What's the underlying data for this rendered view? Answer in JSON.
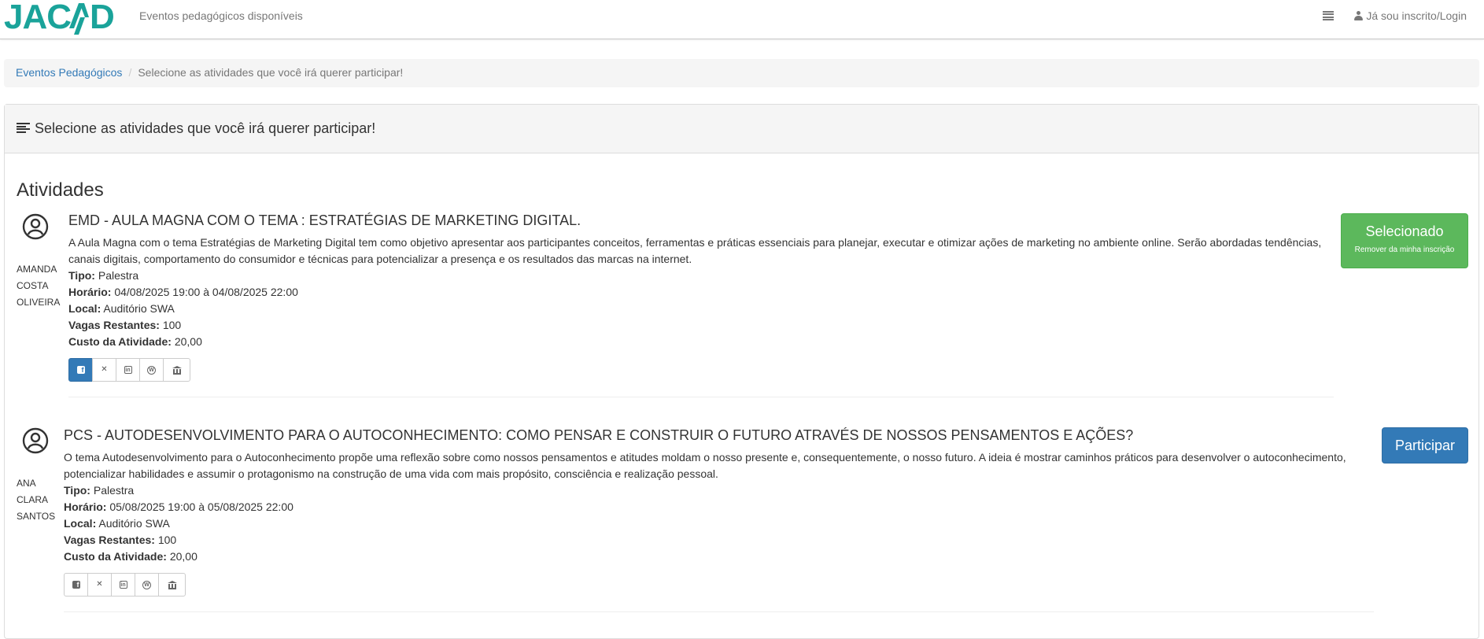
{
  "header": {
    "logo_text": "JACAD",
    "subtitle": "Eventos pedagógicos disponíveis",
    "login_label": "Já sou inscrito/Login"
  },
  "breadcrumb": {
    "root": "Eventos Pedagógicos",
    "separator": "/",
    "current": "Selecione as atividades que você irá querer participar!"
  },
  "panel": {
    "heading": "Selecione as atividades que você irá querer participar!",
    "section_title": "Atividades"
  },
  "labels": {
    "tipo": "Tipo:",
    "horario": "Horário:",
    "local": "Local:",
    "vagas": "Vagas Restantes:",
    "custo": "Custo da Atividade:"
  },
  "activities": [
    {
      "speaker_lines": [
        "AMANDA",
        "COSTA",
        "OLIVEIRA"
      ],
      "title": "EMD - AULA MAGNA COM O TEMA : ESTRATÉGIAS DE MARKETING DIGITAL.",
      "description": "A Aula Magna com o tema Estratégias de Marketing Digital tem como objetivo apresentar aos participantes conceitos, ferramentas e práticas essenciais para planejar, executar e otimizar ações de marketing no ambiente online. Serão abordadas tendências, canais digitais, comportamento do consumidor e técnicas para potencializar a presença e os resultados das marcas na internet.",
      "tipo": "Palestra",
      "horario": "04/08/2025 19:00 à 04/08/2025 22:00",
      "local": "Auditório SWA",
      "vagas": "100",
      "custo": "20,00",
      "button_main": "Selecionado",
      "button_sub": "Remover da minha inscrição"
    },
    {
      "speaker_lines": [
        "ANA",
        "CLARA",
        "SANTOS"
      ],
      "title": "PCS - AUTODESENVOLVIMENTO PARA O AUTOCONHECIMENTO: COMO PENSAR E CONSTRUIR O FUTURO ATRAVÉS DE NOSSOS PENSAMENTOS E AÇÕES?",
      "description": "O tema Autodesenvolvimento para o Autoconhecimento propõe uma reflexão sobre como nossos pensamentos e atitudes moldam o nosso presente e, consequentemente, o nosso futuro. A ideia é mostrar caminhos práticos para desenvolver o autoconhecimento, potencializar habilidades e assumir o protagonismo na construção de uma vida com mais propósito, consciência e realização pessoal.",
      "tipo": "Palestra",
      "horario": "05/08/2025 19:00 à 05/08/2025 22:00",
      "local": "Auditório SWA",
      "vagas": "100",
      "custo": "20,00",
      "button_main": "Participar"
    }
  ],
  "icons": {
    "share": [
      "facebook-icon",
      "x-twitter-icon",
      "linkedin-icon",
      "wordpress-icon",
      "institution-icon"
    ]
  },
  "colors": {
    "brand": "#1aa39a",
    "link": "#337ab7",
    "selected_green": "#5cb85c",
    "primary_blue": "#337ab7"
  }
}
